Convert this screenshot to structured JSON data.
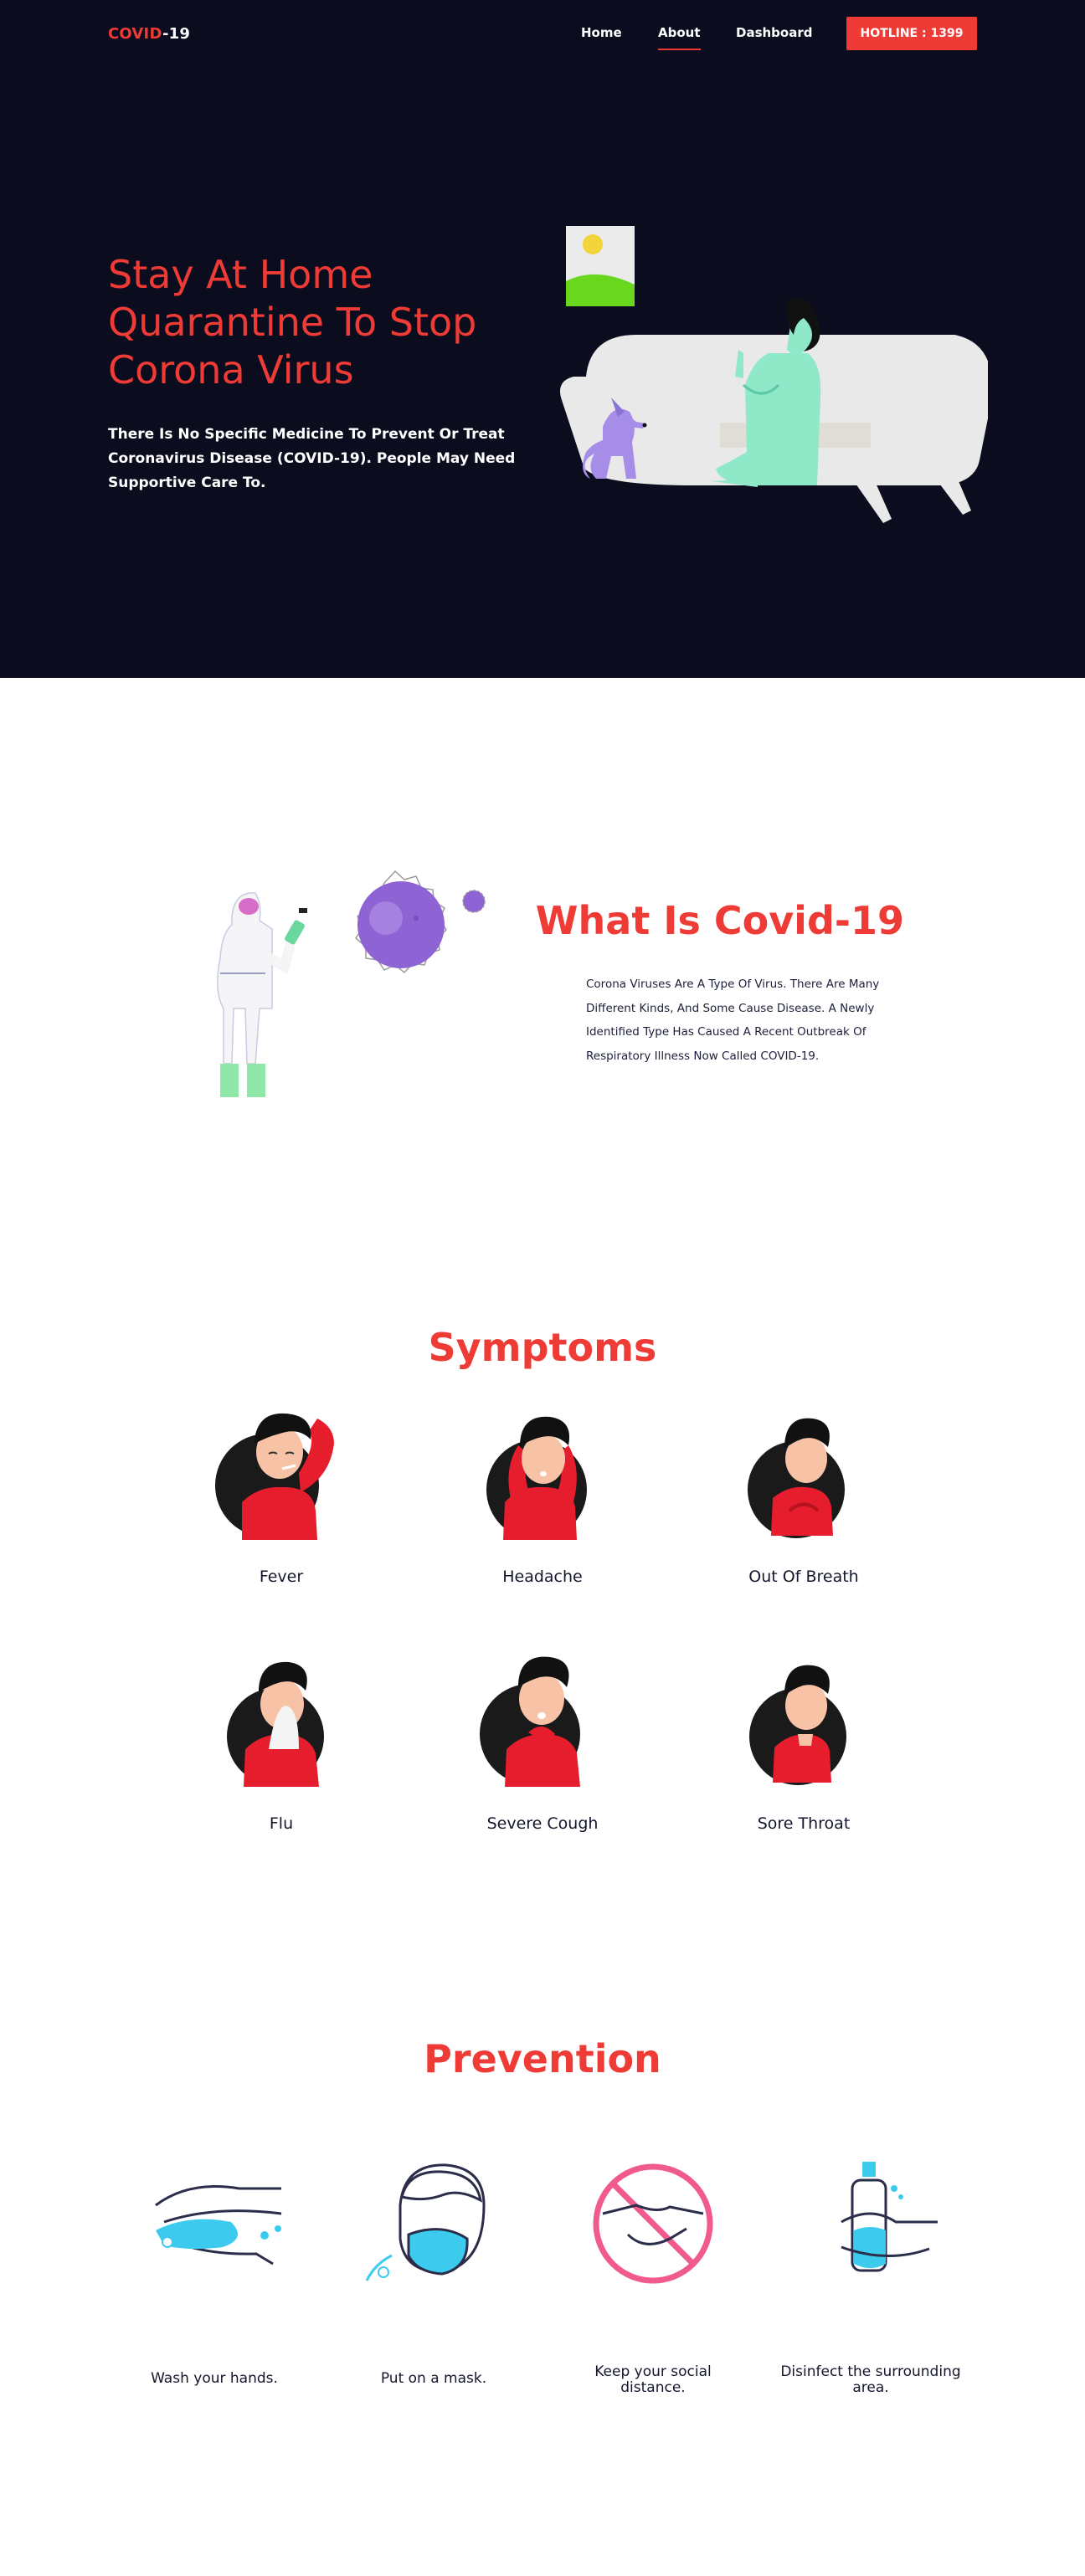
{
  "nav": {
    "logo_accent": "COVID",
    "logo_rest": "-19",
    "links": [
      {
        "label": "Home",
        "active": false
      },
      {
        "label": "About",
        "active": true
      },
      {
        "label": "Dashboard",
        "active": false
      }
    ],
    "hotline_label": "HOTLINE : 1399"
  },
  "hero": {
    "title": "Stay At Home Quarantine To Stop Corona Virus",
    "subtitle": "There Is No Specific Medicine To Prevent Or Treat Coronavirus Disease (COVID-19). People May Need Supportive Care To."
  },
  "what_is": {
    "title": "What Is Covid-19",
    "description": "Corona Viruses Are A Type Of Virus. There Are Many Different Kinds, And Some Cause Disease. A Newly Identified Type Has Caused A Recent Outbreak Of Respiratory Illness Now Called COVID-19."
  },
  "symptoms": {
    "title": "Symptoms",
    "items": [
      {
        "label": "Fever",
        "icon": "fever-person-icon"
      },
      {
        "label": "Headache",
        "icon": "headache-person-icon"
      },
      {
        "label": "Out Of Breath",
        "icon": "breath-person-icon"
      },
      {
        "label": "Flu",
        "icon": "flu-person-icon"
      },
      {
        "label": "Severe Cough",
        "icon": "cough-person-icon"
      },
      {
        "label": "Sore Throat",
        "icon": "throat-person-icon"
      }
    ]
  },
  "prevention": {
    "title": "Prevention",
    "items": [
      {
        "label": "Wash your hands.",
        "icon": "wash-hands-icon"
      },
      {
        "label": "Put on a mask.",
        "icon": "mask-icon"
      },
      {
        "label": "Keep your social distance.",
        "icon": "no-handshake-icon"
      },
      {
        "label": "Disinfect the surrounding area.",
        "icon": "sanitizer-icon"
      }
    ]
  },
  "colors": {
    "accent": "#ef3b36",
    "hero_bg": "#0b0d1f",
    "text_dark": "#14162c"
  }
}
